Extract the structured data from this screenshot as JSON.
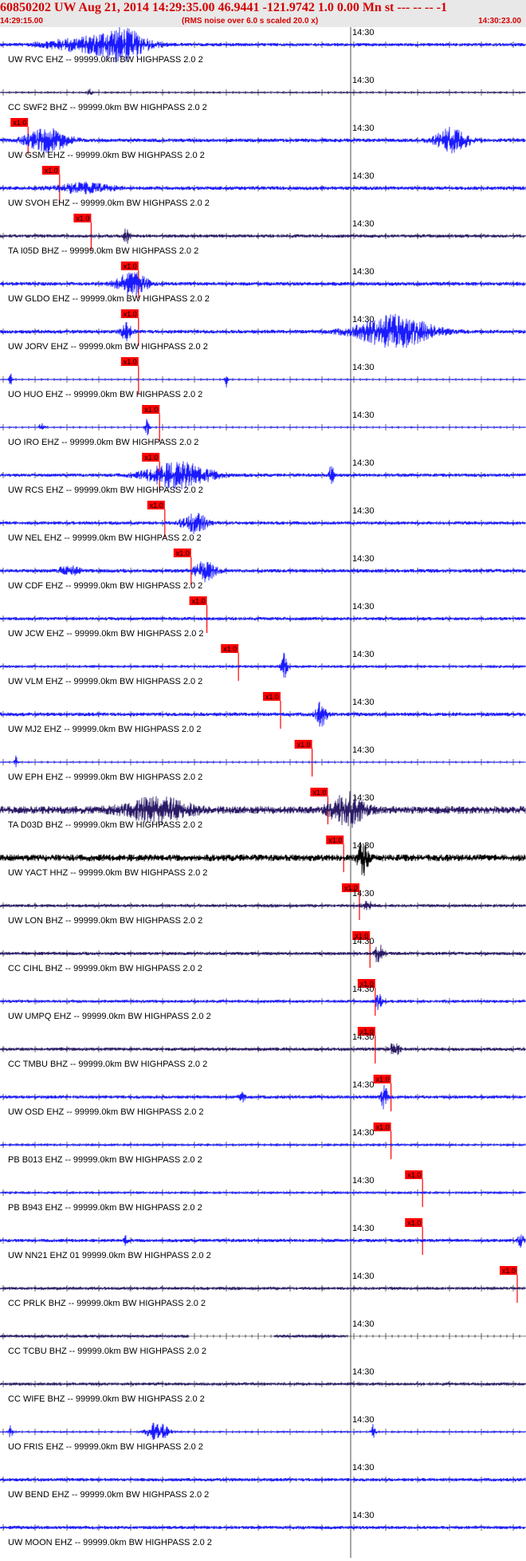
{
  "header": {
    "title": "60850202 UW Aug 21, 2014 14:29:35.00   46.9441 -121.9742  1.0 0.00 Mn st --- -- --   -1",
    "start_time": "14:29:15.00",
    "noise_note": "(RMS noise over 6.0 s scaled 20.0 x)",
    "end_time": "14:30:23.00"
  },
  "colors": {
    "trace_blue": "#1a1aff",
    "trace_navy": "#2a1a66",
    "trace_black": "#000000",
    "pick_red": "#ff0000",
    "header_bg": "#e8e8e8"
  },
  "time_marker_label": "14:30",
  "channels": [
    {
      "label": "UW RVC EHZ -- 99999.0km BW  HIGHPASS  2.0  2",
      "color": "blue",
      "pick_label": "",
      "pick": 0.0,
      "events": [
        [
          0.23,
          0.05,
          1.0
        ],
        [
          0.14,
          0.06,
          0.35
        ]
      ],
      "base": 0.1
    },
    {
      "label": "CC SWF2 BHZ -- 99999.0km BW  HIGHPASS  2.0  2",
      "color": "navy",
      "pick_label": "x1.0",
      "pick": 0.02,
      "events": [
        [
          0.17,
          0.005,
          0.25
        ]
      ],
      "base": 0.03
    },
    {
      "label": "UW GSM EHZ -- 99999.0km BW  HIGHPASS  2.0  2",
      "color": "blue",
      "pick_label": "x1.0",
      "pick": 0.08,
      "events": [
        [
          0.09,
          0.04,
          0.7
        ],
        [
          0.86,
          0.03,
          0.8
        ]
      ],
      "base": 0.12
    },
    {
      "label": "UW SVOH EHZ -- 99999.0km BW  HIGHPASS  2.0  2",
      "color": "blue",
      "pick_label": "x1.0",
      "pick": 0.14,
      "events": [
        [
          0.16,
          0.05,
          0.3
        ]
      ],
      "base": 0.12
    },
    {
      "label": "TA I05D BHZ -- 99999.0km BW  HIGHPASS  2.0  2",
      "color": "navy",
      "pick_label": "x1.0",
      "pick": 0.23,
      "events": [
        [
          0.24,
          0.005,
          0.5
        ]
      ],
      "base": 0.1
    },
    {
      "label": "UW GLDO EHZ -- 99999.0km BW  HIGHPASS  2.0  2",
      "color": "blue",
      "pick_label": "x1.0",
      "pick": 0.23,
      "events": [
        [
          0.25,
          0.03,
          0.7
        ]
      ],
      "base": 0.12
    },
    {
      "label": "UW JORV EHZ -- 99999.0km BW  HIGHPASS  2.0  2",
      "color": "blue",
      "pick_label": "x1.0",
      "pick": 0.23,
      "events": [
        [
          0.75,
          0.07,
          1.0
        ],
        [
          0.24,
          0.01,
          0.5
        ]
      ],
      "base": 0.12
    },
    {
      "label": "UO HUO EHZ -- 99999.0km BW  HIGHPASS  2.0  2",
      "color": "blue",
      "pick_label": "x1.0",
      "pick": 0.27,
      "events": [
        [
          0.02,
          0.003,
          0.5
        ],
        [
          0.43,
          0.003,
          0.5
        ]
      ],
      "base": 0.02
    },
    {
      "label": "UO IRO EHZ -- 99999.0km BW  HIGHPASS  2.0  2",
      "color": "blue",
      "pick_label": "x1.0",
      "pick": 0.27,
      "events": [
        [
          0.08,
          0.005,
          0.4
        ],
        [
          0.28,
          0.004,
          0.6
        ]
      ],
      "base": 0.02
    },
    {
      "label": "UW RCS EHZ -- 99999.0km BW  HIGHPASS  2.0  2",
      "color": "blue",
      "pick_label": "x1.0",
      "pick": 0.28,
      "events": [
        [
          0.34,
          0.06,
          0.8
        ],
        [
          0.63,
          0.005,
          0.6
        ]
      ],
      "base": 0.1
    },
    {
      "label": "UW NEL EHZ -- 99999.0km BW  HIGHPASS  2.0  2",
      "color": "blue",
      "pick_label": "x1.0",
      "pick": 0.33,
      "events": [
        [
          0.37,
          0.025,
          0.6
        ]
      ],
      "base": 0.1
    },
    {
      "label": "UW CDF EHZ -- 99999.0km BW  HIGHPASS  2.0  2",
      "color": "blue",
      "pick_label": "x1.0",
      "pick": 0.36,
      "events": [
        [
          0.39,
          0.02,
          0.6
        ],
        [
          0.13,
          0.02,
          0.3
        ]
      ],
      "base": 0.12
    },
    {
      "label": "UW JCW EHZ -- 99999.0km BW  HIGHPASS  2.0  2",
      "color": "blue",
      "pick_label": "x1.0",
      "pick": 0.42,
      "events": [],
      "base": 0.1
    },
    {
      "label": "UW VLM EHZ -- 99999.0km BW  HIGHPASS  2.0  2",
      "color": "blue",
      "pick_label": "x1.0",
      "pick": 0.5,
      "events": [
        [
          0.54,
          0.006,
          1.0
        ]
      ],
      "base": 0.06
    },
    {
      "label": "UW MJ2 EHZ -- 99999.0km BW  HIGHPASS  2.0  2",
      "color": "blue",
      "pick_label": "x1.0",
      "pick": 0.56,
      "events": [
        [
          0.61,
          0.01,
          0.8
        ]
      ],
      "base": 0.12
    },
    {
      "label": "UW EPH EHZ -- 99999.0km BW  HIGHPASS  2.0  2",
      "color": "blue",
      "pick_label": "x1.0",
      "pick": 0.59,
      "events": [
        [
          0.03,
          0.003,
          0.5
        ]
      ],
      "base": 0.02
    },
    {
      "label": "TA D03D BHZ -- 99999.0km BW  HIGHPASS  2.0  2",
      "color": "navy",
      "pick_label": "x1.0",
      "pick": 0.62,
      "events": [
        [
          0.66,
          0.03,
          1.0
        ],
        [
          0.3,
          0.06,
          0.7
        ]
      ],
      "base": 0.25
    },
    {
      "label": "UW YACT HHZ -- 99999.0km BW  HIGHPASS  2.0  2",
      "color": "black",
      "pick_label": "x1.0",
      "pick": 0.65,
      "events": [
        [
          0.69,
          0.01,
          1.0
        ]
      ],
      "base": 0.22
    },
    {
      "label": "UW LON BHZ -- 99999.0km BW  HIGHPASS  2.0  2",
      "color": "navy",
      "pick_label": "x1.0",
      "pick": 0.67,
      "events": [
        [
          0.7,
          0.01,
          0.3
        ]
      ],
      "base": 0.08
    },
    {
      "label": "CC CIHL BHZ -- 99999.0km BW  HIGHPASS  2.0  2",
      "color": "navy",
      "pick_label": "x1.0",
      "pick": 0.68,
      "events": [
        [
          0.72,
          0.006,
          0.9
        ]
      ],
      "base": 0.1
    },
    {
      "label": "UW UMPQ EHZ -- 99999.0km BW  HIGHPASS  2.0  2",
      "color": "blue",
      "pick_label": "x1.0",
      "pick": 0.68,
      "events": [
        [
          0.72,
          0.006,
          0.6
        ]
      ],
      "base": 0.08
    },
    {
      "label": "CC TMBU BHZ -- 99999.0km BW  HIGHPASS  2.0  2",
      "color": "navy",
      "pick_label": "x1.0",
      "pick": 0.71,
      "events": [
        [
          0.75,
          0.01,
          0.4
        ]
      ],
      "base": 0.1
    },
    {
      "label": "UW OSD EHZ -- 99999.0km BW  HIGHPASS  2.0  2",
      "color": "blue",
      "pick_label": "x1.0",
      "pick": 0.71,
      "events": [
        [
          0.73,
          0.006,
          0.9
        ],
        [
          0.46,
          0.005,
          0.4
        ]
      ],
      "base": 0.1
    },
    {
      "label": "PB B013 EHZ -- 99999.0km BW  HIGHPASS  2.0  2",
      "color": "blue",
      "pick_label": "x1.0",
      "pick": 0.77,
      "events": [],
      "base": 0.05
    },
    {
      "label": "PB B943 EHZ -- 99999.0km BW  HIGHPASS  2.0  2",
      "color": "blue",
      "pick_label": "x1.0",
      "pick": 0.77,
      "events": [],
      "base": 0.05
    },
    {
      "label": "UW NN21 EHZ 01 99999.0km BW  HIGHPASS  2.0  2",
      "color": "blue",
      "pick_label": "x1.0",
      "pick": 0.95,
      "events": [
        [
          0.24,
          0.004,
          0.4
        ],
        [
          0.99,
          0.005,
          0.5
        ]
      ],
      "base": 0.1
    },
    {
      "label": "CC PRLK BHZ -- 99999.0km BW  HIGHPASS  2.0  2",
      "color": "navy",
      "pick_label": "",
      "pick": 0,
      "events": [],
      "base": 0.08
    },
    {
      "label": "CC TCBU BHZ -- 99999.0km BW  HIGHPASS  2.0  2",
      "color": "navy",
      "pick_label": "",
      "pick": 0,
      "events": [],
      "base": 0.08,
      "gaps": [
        [
          0.36,
          0.52
        ],
        [
          0.66,
          1.0
        ]
      ]
    },
    {
      "label": "CC WIFE BHZ -- 99999.0km BW  HIGHPASS  2.0  2",
      "color": "navy",
      "pick_label": "",
      "pick": 0,
      "events": [],
      "base": 0.08
    },
    {
      "label": "UO FRIS EHZ -- 99999.0km BW  HIGHPASS  2.0  2",
      "color": "blue",
      "pick_label": "",
      "pick": 0,
      "events": [
        [
          0.02,
          0.004,
          0.4
        ],
        [
          0.3,
          0.02,
          0.7
        ],
        [
          0.71,
          0.004,
          0.5
        ]
      ],
      "base": 0.03
    },
    {
      "label": "UW BEND EHZ -- 99999.0km BW  HIGHPASS  2.0  2",
      "color": "blue",
      "pick_label": "",
      "pick": 0,
      "events": [],
      "base": 0.1
    },
    {
      "label": "UW MOON EHZ -- 99999.0km BW  HIGHPASS  2.0  2",
      "color": "blue",
      "pick_label": "",
      "pick": 0,
      "events": [],
      "base": 0.1
    }
  ]
}
